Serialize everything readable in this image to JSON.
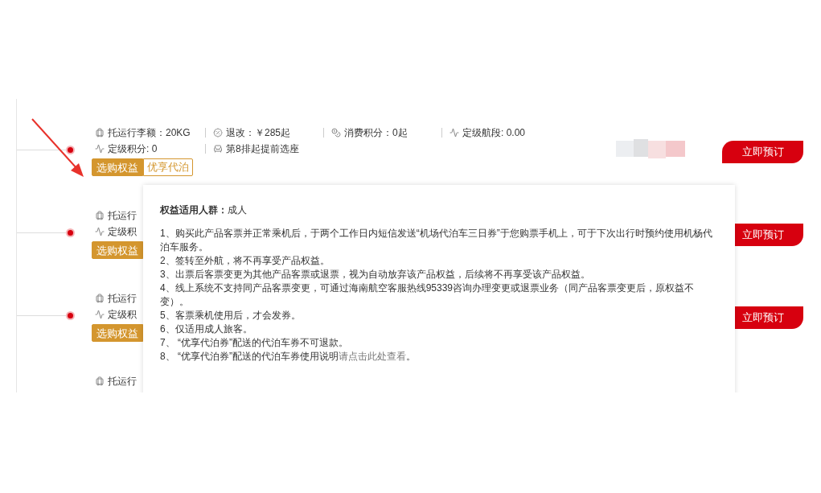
{
  "rows": [
    {
      "kind": "full",
      "baggage": "托运行李额：20KG",
      "refund": "退改：￥285起",
      "points_spend": "消费积分：0起",
      "grade_segments": "定级航段: 0.00",
      "grade_points": "定级积分: 0",
      "seat": "第8排起提前选座",
      "tags": [
        "选购权益",
        "优享代泊"
      ],
      "masked": true,
      "button": "立即预订"
    },
    {
      "kind": "covered",
      "baggage": "托运行",
      "grade_points": "定级积",
      "tags": [
        "选购权益"
      ],
      "button": "立即预订"
    },
    {
      "kind": "covered",
      "baggage": "托运行",
      "grade_points": "定级积",
      "tags": [
        "选购权益"
      ],
      "button": "立即预订"
    },
    {
      "kind": "clipped",
      "baggage": "托运行"
    }
  ],
  "popover": {
    "audience_label": "权益适用人群：",
    "audience": "成人",
    "items": [
      {
        "text": "1、购买此产品客票并正常乘机后，于两个工作日内短信发送“机场代泊车三日券”于您购票手机上，可于下次出行时预约使用机杨代泊车服务。"
      },
      {
        "text": "2、签转至外航，将不再享受产品权益。"
      },
      {
        "text": "3、出票后客票变更为其他产品客票或退票，视为自动放弃该产品权益，后续将不再享受该产品权益。"
      },
      {
        "text": "4、线上系统不支持同产品客票变更，可通过海南航空客服热线95339咨询办理变更或退票业务（同产品客票变更后，原权益不变）。"
      },
      {
        "text": "5、客票乘机使用后，才会发券。"
      },
      {
        "text": "6、仅适用成人旅客。"
      },
      {
        "text": "7、 “优享代泊券”配送的代泊车券不可退款。"
      },
      {
        "text": "8、 “优享代泊券”配送的代泊车券使用说明",
        "link": "请点击此处查看",
        "after": "。"
      }
    ]
  }
}
